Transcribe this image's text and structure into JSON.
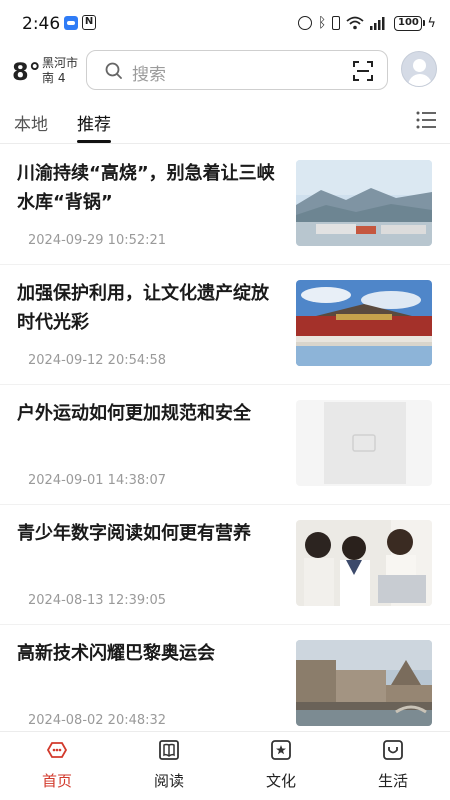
{
  "status_bar": {
    "time": "2:46",
    "nfc": "N",
    "battery": "100"
  },
  "header": {
    "weather": {
      "temperature": "8°",
      "city": "黑河市",
      "wind": "南 4"
    },
    "search": {
      "placeholder": "搜索"
    }
  },
  "tabs": [
    {
      "label": "本地",
      "active": false
    },
    {
      "label": "推荐",
      "active": true
    }
  ],
  "news": [
    {
      "title": "川渝持续“高烧”，别急着让三峡水库“背锅”",
      "time": "2024-09-29 10:52:21",
      "image": "reservoir-landscape"
    },
    {
      "title": "加强保护利用，让文化遗产绽放时代光彩",
      "time": "2024-09-12 20:54:58",
      "image": "forbidden-city"
    },
    {
      "title": "户外运动如何更加规范和安全",
      "time": "2024-09-01 14:38:07",
      "image": "placeholder"
    },
    {
      "title": "青少年数字阅读如何更有营养",
      "time": "2024-08-13 12:39:05",
      "image": "students-laptop"
    },
    {
      "title": "高新技术闪耀巴黎奥运会",
      "time": "2024-08-02 20:48:32",
      "image": "paris-city"
    }
  ],
  "bottom_nav": [
    {
      "label": "首页",
      "icon": "home-icon",
      "active": true
    },
    {
      "label": "阅读",
      "icon": "book-icon",
      "active": false
    },
    {
      "label": "文化",
      "icon": "culture-icon",
      "active": false
    },
    {
      "label": "生活",
      "icon": "life-icon",
      "active": false
    }
  ],
  "colors": {
    "accent": "#d23a2c",
    "text": "#1a1a1a",
    "muted": "#9a9a9a"
  }
}
